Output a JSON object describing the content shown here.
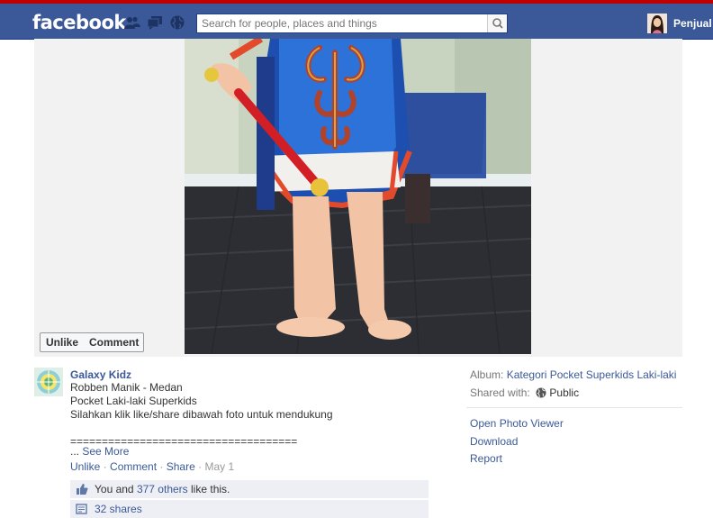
{
  "header": {
    "logo": "facebook",
    "search": {
      "placeholder": "Search for people, places and things"
    },
    "user": {
      "name": "Penjual"
    },
    "icons": [
      "friend-requests-icon",
      "messages-icon",
      "notifications-globe-icon",
      "search-icon"
    ]
  },
  "photo": {
    "alt": "Child in traditional costume holding red stick",
    "actions": {
      "unlike": "Unlike",
      "comment": "Comment"
    }
  },
  "post": {
    "poster_name": "Galaxy Kidz",
    "caption_lines": [
      "Robben Manik - Medan",
      "Pocket Laki-laki Superkids",
      "Silahkan klik like/share dibawah foto untuk mendukung",
      "",
      "===================================="
    ],
    "ellipsis": "...",
    "see_more": "See More",
    "actions": {
      "unlike": "Unlike",
      "comment": "Comment",
      "share": "Share",
      "date": "May 1"
    },
    "likes": {
      "prefix": "You and",
      "others": "377 others",
      "suffix": "like this."
    },
    "shares": "32 shares"
  },
  "sidebar": {
    "album_label": "Album:",
    "album_name": "Kategori Pocket Superkids Laki-laki",
    "shared_with_label": "Shared with:",
    "privacy": "Public",
    "links": [
      "Open Photo Viewer",
      "Download",
      "Report"
    ]
  },
  "colors": {
    "brand_blue": "#3b5998",
    "top_red": "#c00000",
    "link": "#3b5998",
    "muted": "#777777"
  }
}
